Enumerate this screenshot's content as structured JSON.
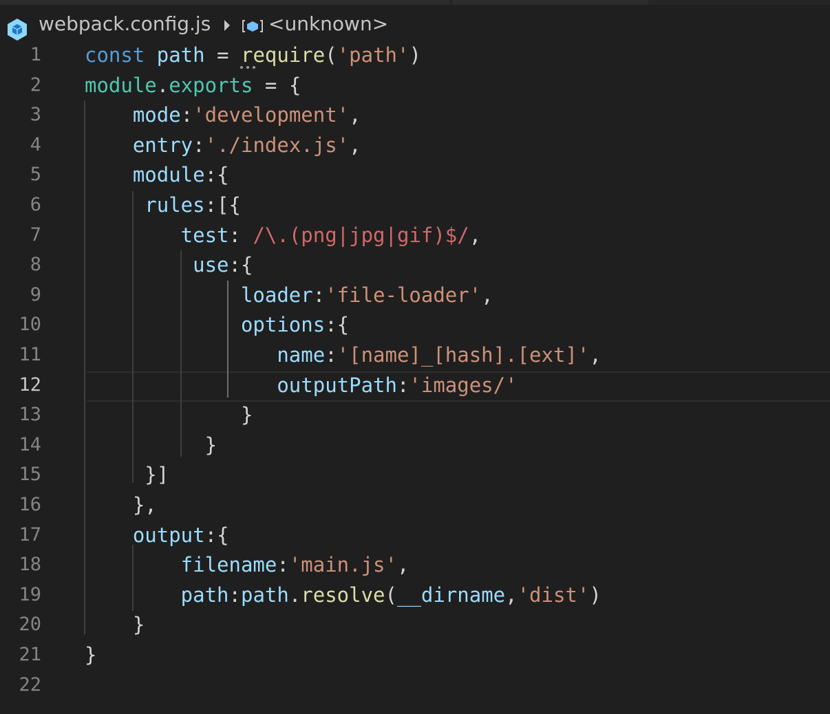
{
  "breadcrumb": {
    "file_name": "webpack.config.js",
    "symbol": "<unknown>",
    "file_icon": "webpack-cube-icon",
    "separator_icon": "chevron-right-icon",
    "symbol_icon": "symbol-namespace-icon"
  },
  "editor": {
    "active_line": 12,
    "line_numbers": [
      "1",
      "2",
      "3",
      "4",
      "5",
      "6",
      "7",
      "8",
      "9",
      "10",
      "11",
      "12",
      "13",
      "14",
      "15",
      "16",
      "17",
      "18",
      "19",
      "20",
      "21",
      "22"
    ],
    "lines": [
      [
        {
          "t": "const ",
          "c": "kw"
        },
        {
          "t": "path",
          "c": "v"
        },
        {
          "t": " = ",
          "c": "p"
        },
        {
          "t": "require",
          "c": "f"
        },
        {
          "t": "(",
          "c": "p"
        },
        {
          "t": "'path'",
          "c": "s"
        },
        {
          "t": ")",
          "c": "p"
        }
      ],
      [
        {
          "t": "module",
          "c": "mod"
        },
        {
          "t": ".",
          "c": "p"
        },
        {
          "t": "exports",
          "c": "mod"
        },
        {
          "t": " = {",
          "c": "p"
        }
      ],
      [
        {
          "t": "    mode",
          "c": "v"
        },
        {
          "t": ":",
          "c": "p"
        },
        {
          "t": "'development'",
          "c": "s"
        },
        {
          "t": ",",
          "c": "p"
        }
      ],
      [
        {
          "t": "    entry",
          "c": "v"
        },
        {
          "t": ":",
          "c": "p"
        },
        {
          "t": "'./index.js'",
          "c": "s"
        },
        {
          "t": ",",
          "c": "p"
        }
      ],
      [
        {
          "t": "    module",
          "c": "v"
        },
        {
          "t": ":{",
          "c": "p"
        }
      ],
      [
        {
          "t": "     rules",
          "c": "v"
        },
        {
          "t": ":[{",
          "c": "p"
        }
      ],
      [
        {
          "t": "        test",
          "c": "v"
        },
        {
          "t": ": ",
          "c": "p"
        },
        {
          "t": "/\\.(png|jpg|gif)$/",
          "c": "re"
        },
        {
          "t": ",",
          "c": "p"
        }
      ],
      [
        {
          "t": "         use",
          "c": "v"
        },
        {
          "t": ":{",
          "c": "p"
        }
      ],
      [
        {
          "t": "             loader",
          "c": "v"
        },
        {
          "t": ":",
          "c": "p"
        },
        {
          "t": "'file-loader'",
          "c": "s"
        },
        {
          "t": ",",
          "c": "p"
        }
      ],
      [
        {
          "t": "             options",
          "c": "v"
        },
        {
          "t": ":{",
          "c": "p"
        }
      ],
      [
        {
          "t": "                name",
          "c": "v"
        },
        {
          "t": ":",
          "c": "p"
        },
        {
          "t": "'[name]_[hash].[ext]'",
          "c": "s"
        },
        {
          "t": ",",
          "c": "p"
        }
      ],
      [
        {
          "t": "                outputPath",
          "c": "v"
        },
        {
          "t": ":",
          "c": "p"
        },
        {
          "t": "'images/'",
          "c": "s"
        }
      ],
      [
        {
          "t": "             }",
          "c": "p"
        }
      ],
      [
        {
          "t": "          }",
          "c": "p"
        }
      ],
      [
        {
          "t": "     }]",
          "c": "p"
        }
      ],
      [
        {
          "t": "    },",
          "c": "p"
        }
      ],
      [
        {
          "t": "    output",
          "c": "v"
        },
        {
          "t": ":{",
          "c": "p"
        }
      ],
      [
        {
          "t": "        filename",
          "c": "v"
        },
        {
          "t": ":",
          "c": "p"
        },
        {
          "t": "'main.js'",
          "c": "s"
        },
        {
          "t": ",",
          "c": "p"
        }
      ],
      [
        {
          "t": "        path",
          "c": "v"
        },
        {
          "t": ":",
          "c": "p"
        },
        {
          "t": "path",
          "c": "v"
        },
        {
          "t": ".",
          "c": "p"
        },
        {
          "t": "resolve",
          "c": "f"
        },
        {
          "t": "(",
          "c": "p"
        },
        {
          "t": "__dirname",
          "c": "v"
        },
        {
          "t": ",",
          "c": "p"
        },
        {
          "t": "'dist'",
          "c": "s"
        },
        {
          "t": ")",
          "c": "p"
        }
      ],
      [
        {
          "t": "    }",
          "c": "p"
        }
      ],
      [
        {
          "t": "}",
          "c": "p"
        }
      ],
      []
    ]
  },
  "colors": {
    "background": "#1f1f1f",
    "keyword": "#569cd6",
    "variable": "#9cdcfe",
    "function": "#dcdcaa",
    "module": "#4ec9b0",
    "string": "#ce9178",
    "regex": "#d16969",
    "line_number": "#858585",
    "webpack_icon": "#8ed6fb",
    "symbol_icon": "#75beff"
  }
}
